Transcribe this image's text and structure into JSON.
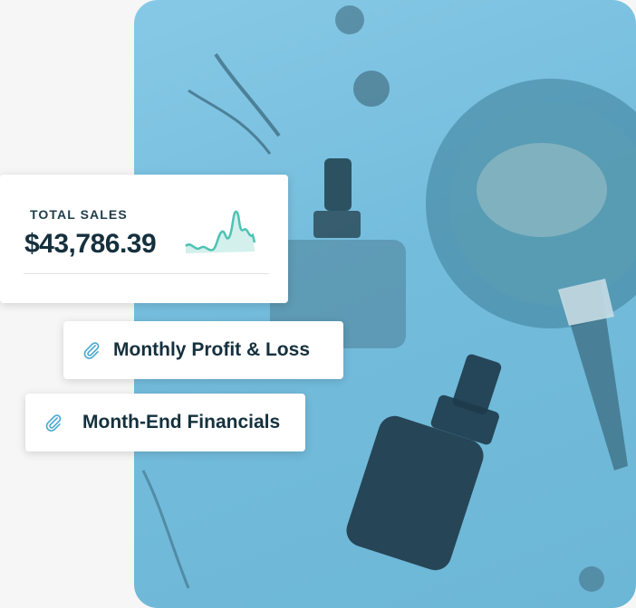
{
  "sales_card": {
    "label": "TOTAL SALES",
    "value": "$43,786.39"
  },
  "links": [
    {
      "label": "Monthly Profit & Loss",
      "icon": "paperclip-icon"
    },
    {
      "label": "Month-End Financials",
      "icon": "paperclip-icon"
    }
  ],
  "colors": {
    "accent": "#4ec2b4",
    "text_dark": "#15303d",
    "hero_tint": "#7ec4e2"
  }
}
